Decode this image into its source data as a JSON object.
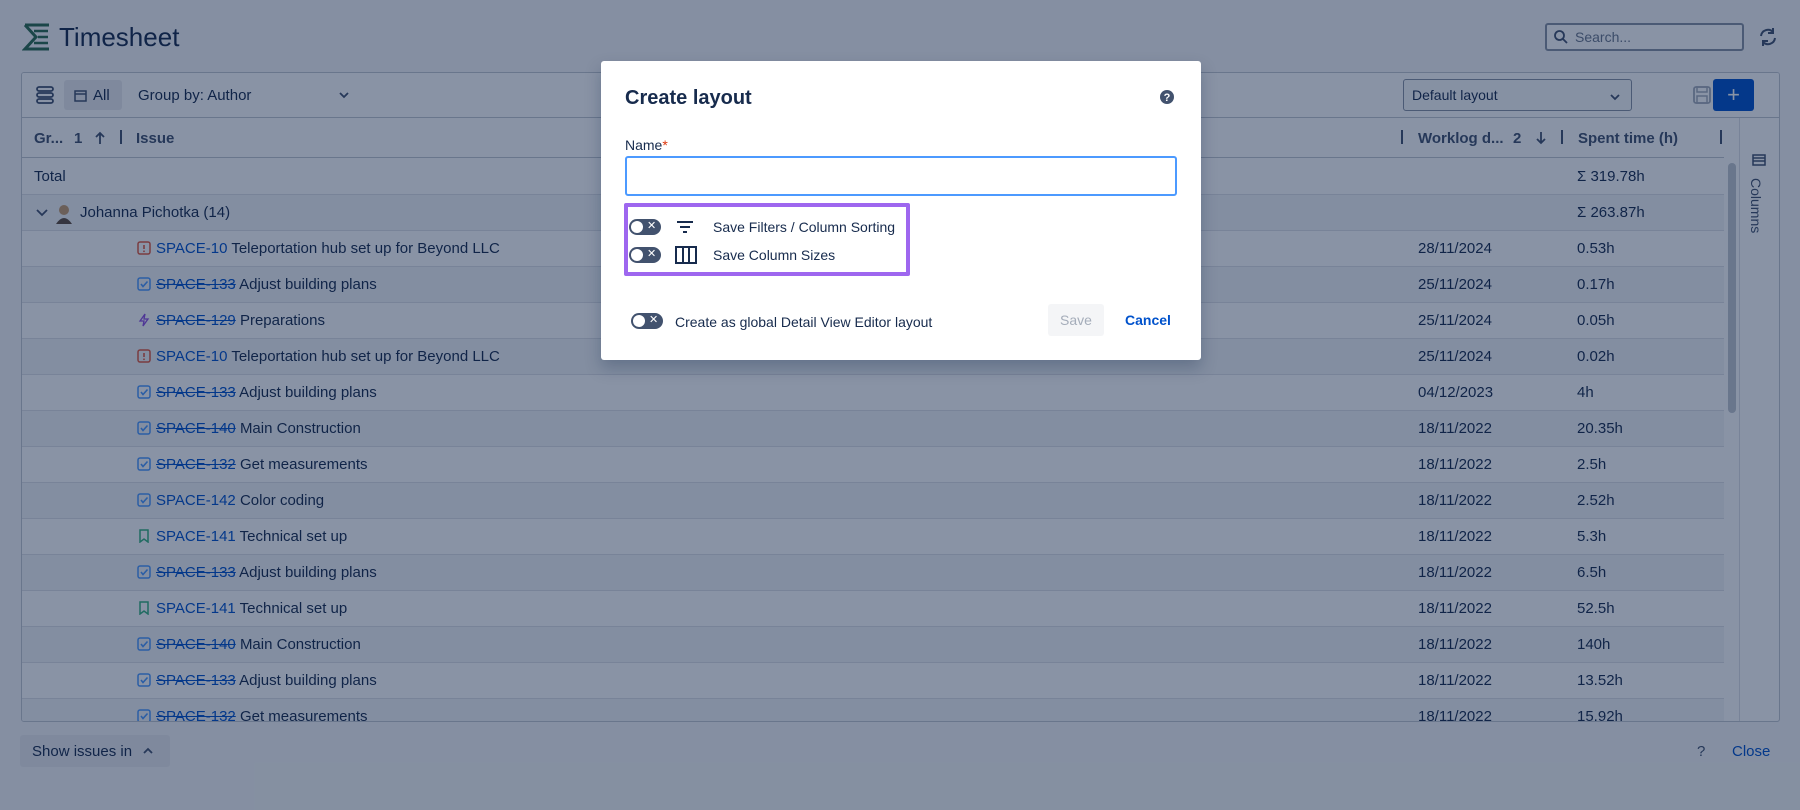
{
  "header": {
    "title": "Timesheet",
    "search_placeholder": "Search..."
  },
  "toolbar": {
    "filter_label": "All",
    "group_by": "Group by: Author",
    "layout": "Default layout"
  },
  "table": {
    "columns": {
      "group": "Gr...",
      "group_sort_index": "1",
      "issue": "Issue",
      "worklog": "Worklog d...",
      "worklog_sort_index": "2",
      "spent": "Spent time (h)"
    },
    "total_label": "Total",
    "total_value": "Σ 319.78h",
    "group_row": {
      "author": "Johanna Pichotka (14)",
      "total": "Σ 263.87h"
    },
    "rows": [
      {
        "type": "bug",
        "key": "SPACE-10",
        "done": false,
        "summary": "Teleportation hub set up for Beyond LLC",
        "date": "28/11/2024",
        "spent": "0.53h"
      },
      {
        "type": "task",
        "key": "SPACE-133",
        "done": true,
        "summary": "Adjust building plans",
        "date": "25/11/2024",
        "spent": "0.17h"
      },
      {
        "type": "epic",
        "key": "SPACE-129",
        "done": true,
        "summary": "Preparations",
        "date": "25/11/2024",
        "spent": "0.05h"
      },
      {
        "type": "bug",
        "key": "SPACE-10",
        "done": false,
        "summary": "Teleportation hub set up for Beyond LLC",
        "date": "25/11/2024",
        "spent": "0.02h"
      },
      {
        "type": "task",
        "key": "SPACE-133",
        "done": true,
        "summary": "Adjust building plans",
        "date": "04/12/2023",
        "spent": "4h"
      },
      {
        "type": "task",
        "key": "SPACE-140",
        "done": true,
        "summary": "Main Construction",
        "date": "18/11/2022",
        "spent": "20.35h"
      },
      {
        "type": "task",
        "key": "SPACE-132",
        "done": true,
        "summary": "Get measurements",
        "date": "18/11/2022",
        "spent": "2.5h"
      },
      {
        "type": "task",
        "key": "SPACE-142",
        "done": false,
        "summary": "Color coding",
        "date": "18/11/2022",
        "spent": "2.52h"
      },
      {
        "type": "story",
        "key": "SPACE-141",
        "done": false,
        "summary": "Technical set up",
        "date": "18/11/2022",
        "spent": "5.3h"
      },
      {
        "type": "task",
        "key": "SPACE-133",
        "done": true,
        "summary": "Adjust building plans",
        "date": "18/11/2022",
        "spent": "6.5h"
      },
      {
        "type": "story",
        "key": "SPACE-141",
        "done": false,
        "summary": "Technical set up",
        "date": "18/11/2022",
        "spent": "52.5h"
      },
      {
        "type": "task",
        "key": "SPACE-140",
        "done": true,
        "summary": "Main Construction",
        "date": "18/11/2022",
        "spent": "140h"
      },
      {
        "type": "task",
        "key": "SPACE-133",
        "done": true,
        "summary": "Adjust building plans",
        "date": "18/11/2022",
        "spent": "13.52h"
      },
      {
        "type": "task",
        "key": "SPACE-132",
        "done": true,
        "summary": "Get measurements",
        "date": "18/11/2022",
        "spent": "15.92h"
      }
    ],
    "columns_panel_label": "Columns"
  },
  "footer": {
    "show_issues": "Show issues in",
    "help": "?",
    "close": "Close"
  },
  "modal": {
    "title": "Create layout",
    "name_label": "Name",
    "required_mark": "*",
    "name_value": "",
    "options": [
      {
        "label": "Save Filters / Column Sorting",
        "icon": "filter-lines-icon",
        "enabled": false
      },
      {
        "label": "Save Column Sizes",
        "icon": "columns-icon",
        "enabled": false
      }
    ],
    "global_label": "Create as global Detail View Editor layout",
    "global_enabled": false,
    "save_label": "Save",
    "cancel_label": "Cancel"
  },
  "colors": {
    "accent": "#0052cc",
    "highlight": "#9e67ef",
    "bug": "#e2583e",
    "task": "#4c9aff",
    "epic": "#904ee2",
    "story": "#36b37e"
  }
}
